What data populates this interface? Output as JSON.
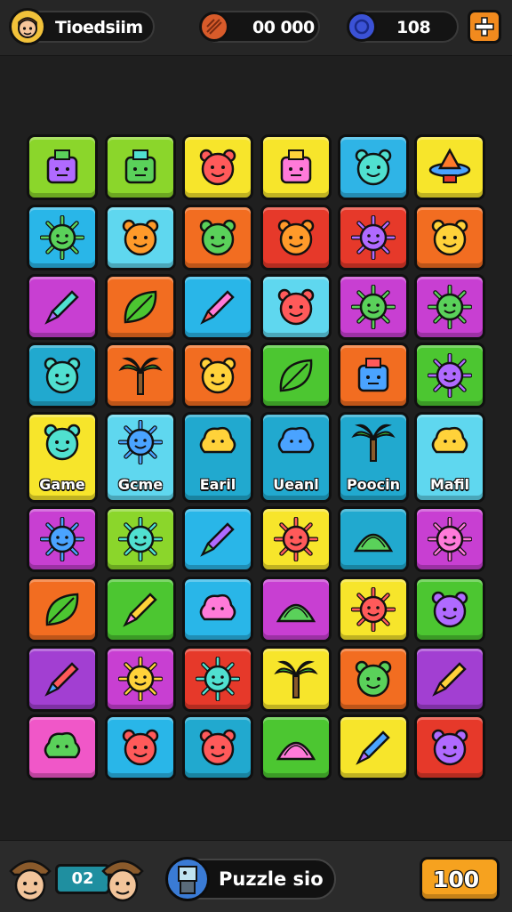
{
  "top_bar": {
    "player_name": "Tioedsiim",
    "coins_value": "00 000",
    "gems_value": "108",
    "icons": {
      "avatar": "player-avatar",
      "coin": "coin-icon",
      "gem": "gem-icon",
      "add": "plus-icon"
    }
  },
  "board": {
    "tiles": [
      {
        "color": "#8bd62b",
        "icon": "kettle",
        "label": ""
      },
      {
        "color": "#8bd62b",
        "icon": "machine",
        "label": ""
      },
      {
        "color": "#f7e52b",
        "icon": "green-fish",
        "label": ""
      },
      {
        "color": "#f7e52b",
        "icon": "robot-head",
        "label": ""
      },
      {
        "color": "#2fb4e6",
        "icon": "orange-face",
        "label": ""
      },
      {
        "color": "#f7e52b",
        "icon": "ufo",
        "label": ""
      },
      {
        "color": "#29b6e8",
        "icon": "sun-face",
        "label": ""
      },
      {
        "color": "#5fd7ef",
        "icon": "pink-cat",
        "label": ""
      },
      {
        "color": "#f26d21",
        "icon": "green-ball",
        "label": ""
      },
      {
        "color": "#e6392a",
        "icon": "red-monkey",
        "label": ""
      },
      {
        "color": "#e6392a",
        "icon": "sun-star",
        "label": ""
      },
      {
        "color": "#f26d21",
        "icon": "blue-cat",
        "label": ""
      },
      {
        "color": "#c83fd2",
        "icon": "blue-pencil",
        "label": ""
      },
      {
        "color": "#f26d21",
        "icon": "leaf",
        "label": ""
      },
      {
        "color": "#29b6e8",
        "icon": "blue-bone",
        "label": ""
      },
      {
        "color": "#5fd7ef",
        "icon": "pink-flower",
        "label": ""
      },
      {
        "color": "#c83fd2",
        "icon": "sun-purple",
        "label": ""
      },
      {
        "color": "#c83fd2",
        "icon": "sun-face-violet",
        "label": ""
      },
      {
        "color": "#21a9cf",
        "icon": "pink-bear",
        "label": ""
      },
      {
        "color": "#f26d21",
        "icon": "palm-tree",
        "label": ""
      },
      {
        "color": "#f26d21",
        "icon": "candy",
        "label": ""
      },
      {
        "color": "#4cc631",
        "icon": "yellow-leaf",
        "label": ""
      },
      {
        "color": "#f26d21",
        "icon": "blue-block",
        "label": ""
      },
      {
        "color": "#4cc631",
        "icon": "sun-smile",
        "label": ""
      },
      {
        "color": "#f7e52b",
        "icon": "red-monkey-face",
        "label": "Game"
      },
      {
        "color": "#5fd7ef",
        "icon": "spiky-sun",
        "label": "Gcme"
      },
      {
        "color": "#21a9cf",
        "icon": "cloud-heart",
        "label": "Earil"
      },
      {
        "color": "#21a9cf",
        "icon": "yellow-blob",
        "label": "Ueanl"
      },
      {
        "color": "#21a9cf",
        "icon": "palm-tree",
        "label": "Poocin"
      },
      {
        "color": "#5fd7ef",
        "icon": "pink-cloud",
        "label": "Mafil"
      },
      {
        "color": "#c83fd2",
        "icon": "purple-sun",
        "label": ""
      },
      {
        "color": "#8bd62b",
        "icon": "orange-sun",
        "label": ""
      },
      {
        "color": "#29b6e8",
        "icon": "carrot",
        "label": ""
      },
      {
        "color": "#f7e52b",
        "icon": "red-sun-green",
        "label": ""
      },
      {
        "color": "#21a9cf",
        "icon": "orange-wedge",
        "label": ""
      },
      {
        "color": "#c83fd2",
        "icon": "yellow-sun",
        "label": ""
      },
      {
        "color": "#f26d21",
        "icon": "green-leaf",
        "label": ""
      },
      {
        "color": "#4cc631",
        "icon": "blue-brush",
        "label": ""
      },
      {
        "color": "#29b6e8",
        "icon": "pink-blob",
        "label": ""
      },
      {
        "color": "#c83fd2",
        "icon": "shell",
        "label": ""
      },
      {
        "color": "#f7e52b",
        "icon": "pink-sun",
        "label": ""
      },
      {
        "color": "#4cc631",
        "icon": "yellow-ball",
        "label": ""
      },
      {
        "color": "#a23fd2",
        "icon": "orange-pen",
        "label": ""
      },
      {
        "color": "#c83fd2",
        "icon": "purple-star-face",
        "label": ""
      },
      {
        "color": "#e6392a",
        "icon": "yellow-star",
        "label": ""
      },
      {
        "color": "#f7e52b",
        "icon": "palm-tree",
        "label": ""
      },
      {
        "color": "#f26d21",
        "icon": "blue-bug",
        "label": ""
      },
      {
        "color": "#a23fd2",
        "icon": "blue-feather",
        "label": ""
      },
      {
        "color": "#f057c8",
        "icon": "green-chat",
        "label": ""
      },
      {
        "color": "#29b6e8",
        "icon": "yellow-monkey",
        "label": ""
      },
      {
        "color": "#21a9cf",
        "icon": "orange-cat",
        "label": ""
      },
      {
        "color": "#4cc631",
        "icon": "watermelon",
        "label": ""
      },
      {
        "color": "#f7e52b",
        "icon": "pink-pen",
        "label": ""
      },
      {
        "color": "#e6392a",
        "icon": "red-cat",
        "label": ""
      }
    ]
  },
  "bottom_bar": {
    "players_count": "02",
    "puzzle_label": "Puzzle sio",
    "score": "100",
    "icons": {
      "left_avatar": "player-avatar",
      "right_avatar": "player-avatar",
      "puzzle": "puzzle-icon",
      "score": "heart-icon"
    }
  }
}
